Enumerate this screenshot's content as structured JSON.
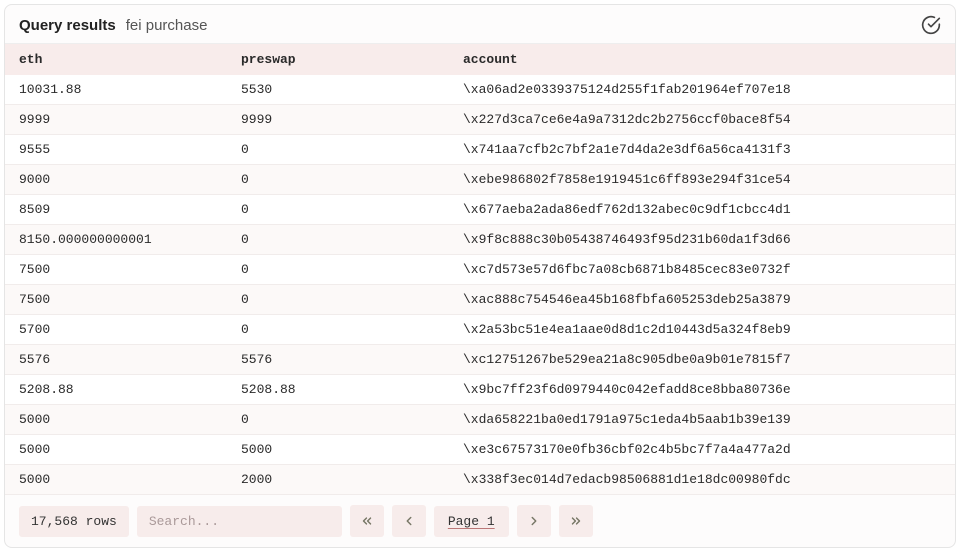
{
  "header": {
    "title": "Query results",
    "subtitle": "fei purchase"
  },
  "columns": {
    "eth": "eth",
    "preswap": "preswap",
    "account": "account"
  },
  "rows": [
    {
      "eth": "10031.88",
      "preswap": "5530",
      "account": "\\xa06ad2e0339375124d255f1fab201964ef707e18"
    },
    {
      "eth": "9999",
      "preswap": "9999",
      "account": "\\x227d3ca7ce6e4a9a7312dc2b2756ccf0bace8f54"
    },
    {
      "eth": "9555",
      "preswap": "0",
      "account": "\\x741aa7cfb2c7bf2a1e7d4da2e3df6a56ca4131f3"
    },
    {
      "eth": "9000",
      "preswap": "0",
      "account": "\\xebe986802f7858e1919451c6ff893e294f31ce54"
    },
    {
      "eth": "8509",
      "preswap": "0",
      "account": "\\x677aeba2ada86edf762d132abec0c9df1cbcc4d1"
    },
    {
      "eth": "8150.000000000001",
      "preswap": "0",
      "account": "\\x9f8c888c30b05438746493f95d231b60da1f3d66"
    },
    {
      "eth": "7500",
      "preswap": "0",
      "account": "\\xc7d573e57d6fbc7a08cb6871b8485cec83e0732f"
    },
    {
      "eth": "7500",
      "preswap": "0",
      "account": "\\xac888c754546ea45b168fbfa605253deb25a3879"
    },
    {
      "eth": "5700",
      "preswap": "0",
      "account": "\\x2a53bc51e4ea1aae0d8d1c2d10443d5a324f8eb9"
    },
    {
      "eth": "5576",
      "preswap": "5576",
      "account": "\\xc12751267be529ea21a8c905dbe0a9b01e7815f7"
    },
    {
      "eth": "5208.88",
      "preswap": "5208.88",
      "account": "\\x9bc7ff23f6d0979440c042efadd8ce8bba80736e"
    },
    {
      "eth": "5000",
      "preswap": "0",
      "account": "\\xda658221ba0ed1791a975c1eda4b5aab1b39e139"
    },
    {
      "eth": "5000",
      "preswap": "5000",
      "account": "\\xe3c67573170e0fb36cbf02c4b5bc7f7a4a477a2d"
    },
    {
      "eth": "5000",
      "preswap": "2000",
      "account": "\\x338f3ec014d7edacb98506881d1e18dc00980fdc"
    }
  ],
  "footer": {
    "rows_label": "17,568 rows",
    "search_placeholder": "Search...",
    "page_label": "Page 1"
  }
}
